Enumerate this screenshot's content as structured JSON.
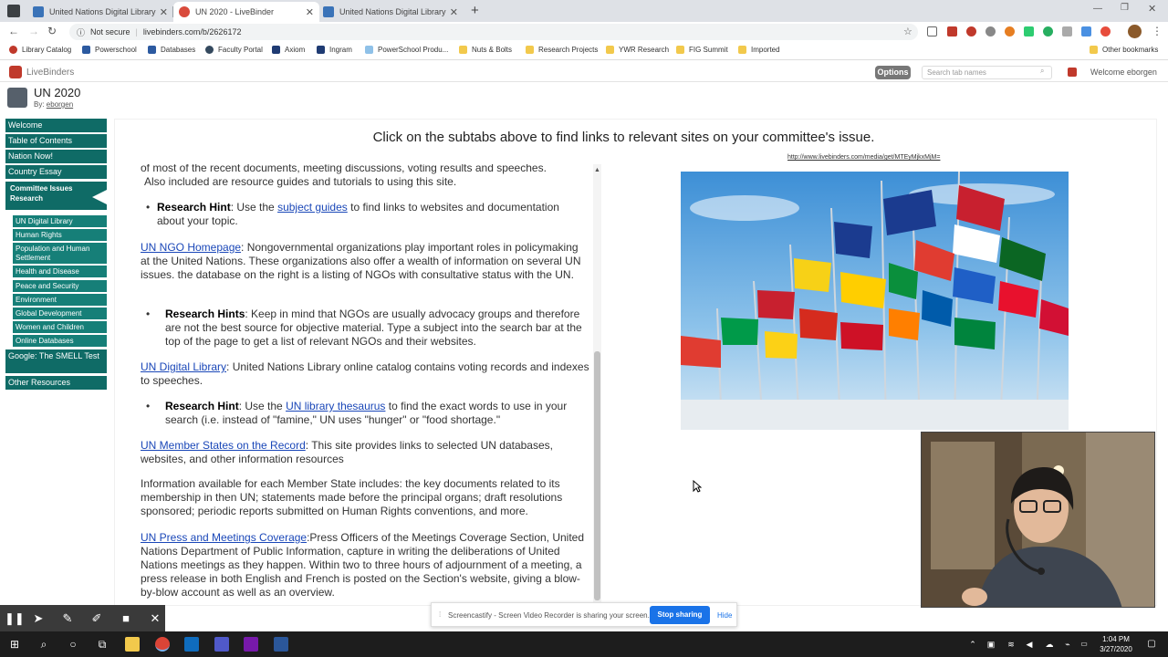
{
  "browser": {
    "tabs": [
      {
        "title": "United Nations Digital Library Sy",
        "active": false
      },
      {
        "title": "UN 2020 - LiveBinder",
        "active": true
      },
      {
        "title": "United Nations Digital Library Sy",
        "active": false
      }
    ],
    "new_tab": "+",
    "security": "Not secure",
    "url": "livebinders.com/b/2626172",
    "bookmarks": [
      "Library Catalog",
      "Powerschool",
      "Databases",
      "Faculty Portal",
      "Axiom",
      "Ingram",
      "PowerSchool Produ...",
      "Nuts & Bolts",
      "Research Projects",
      "YWR Research",
      "FIG Summit",
      "Imported"
    ],
    "other_bookmarks": "Other bookmarks"
  },
  "livebinders": {
    "logo": "LiveBinders",
    "options_label": "Options",
    "search_placeholder": "Search tab names",
    "welcome": "Welcome eborgen",
    "binder_title": "UN 2020",
    "binder_by": "By:",
    "binder_author": "eborgen"
  },
  "sidebar": {
    "tabs": [
      "Welcome",
      "Table of Contents",
      "Nation Now!",
      "Country Essay",
      "Committee Issues Research"
    ],
    "subtabs": [
      "UN Digital Library",
      "Human Rights",
      "Population and Human Settlement",
      "Health and Disease",
      "Peace and Security",
      "Environment",
      "Global Development",
      "Women and Children",
      "Online Databases"
    ],
    "tabs_after": [
      "Google: The SMELL Test",
      "Other Resources"
    ],
    "collapse_glyph": "««"
  },
  "content": {
    "header": "Click on the subtabs above to find links to relevant sites on your committee's issue.",
    "media_link": "http://www.livebinders.com/media/get/MTEyMjkxMjM=",
    "lines": {
      "intro_1": "of most of the recent documents, meeting discussions, voting results and speeches.",
      "intro_2": "Also included are resource guides and tutorials to using this site.",
      "hint1_label": "Research Hint",
      "hint1_pre": ": Use the ",
      "hint1_link": "subject guides",
      "hint1_post": " to find links to websites and documentation about your topic.",
      "ngo_link": "UN NGO Homepage",
      "ngo_text": ": Nongovernmental organizations play important roles in policymaking at the United Nations.  These organizations also offer a wealth of information on several UN issues.  the database on the right is a listing of NGOs with consultative status with the UN.",
      "hint2_label": "Research Hints",
      "hint2_text": ":  Keep in mind that NGOs are usually advocacy groups and therefore are not the best source for objective material.  Type a subject into the search bar at the top of the page to get a list of relevant NGOs and their websites.",
      "dl_link": "UN Digital Library",
      "dl_text": ": United Nations Library online catalog contains voting records and indexes to speeches.",
      "hint3_label": "Research Hint",
      "hint3_pre": ": Use the ",
      "hint3_link": "UN library thesaurus",
      "hint3_post": " to find the exact words to use in your search (i.e. instead of \"famine,\" UN uses \"hunger\" or \"food shortage.\"",
      "ms_link": "UN Member States on the Record",
      "ms_text": ": This site provides links to selected UN databases, websites, and other information resources",
      "info_text": "Information available for each Member State includes: the key documents related to its membership in then UN; statements made before the principal organs; draft resolutions sponsored; periodic reports submitted on Human Rights conventions, and more.",
      "press_link": "UN Press and Meetings Coverage",
      "press_text": ":Press Officers of the Meetings Coverage Section, United Nations Department of Public Information, capture in writing the deliberations of United Nations meetings as they happen.  Within two to three hours of adjournment of a meeting, a press release in both English and French is posted on the Section's website, giving a blow-by-blow account as well as an overview."
    }
  },
  "screencastify": {
    "message": "Screencastify - Screen Video Recorder is sharing your screen.",
    "stop_label": "Stop sharing",
    "hide_label": "Hide"
  },
  "taskbar": {
    "time": "1:04 PM",
    "date": "3/27/2020"
  },
  "colors": {
    "sidebar_tab": "#0f6b66",
    "sidebar_subtab": "#167f78",
    "link": "#1a47b8",
    "stop_button": "#1a73e8"
  }
}
